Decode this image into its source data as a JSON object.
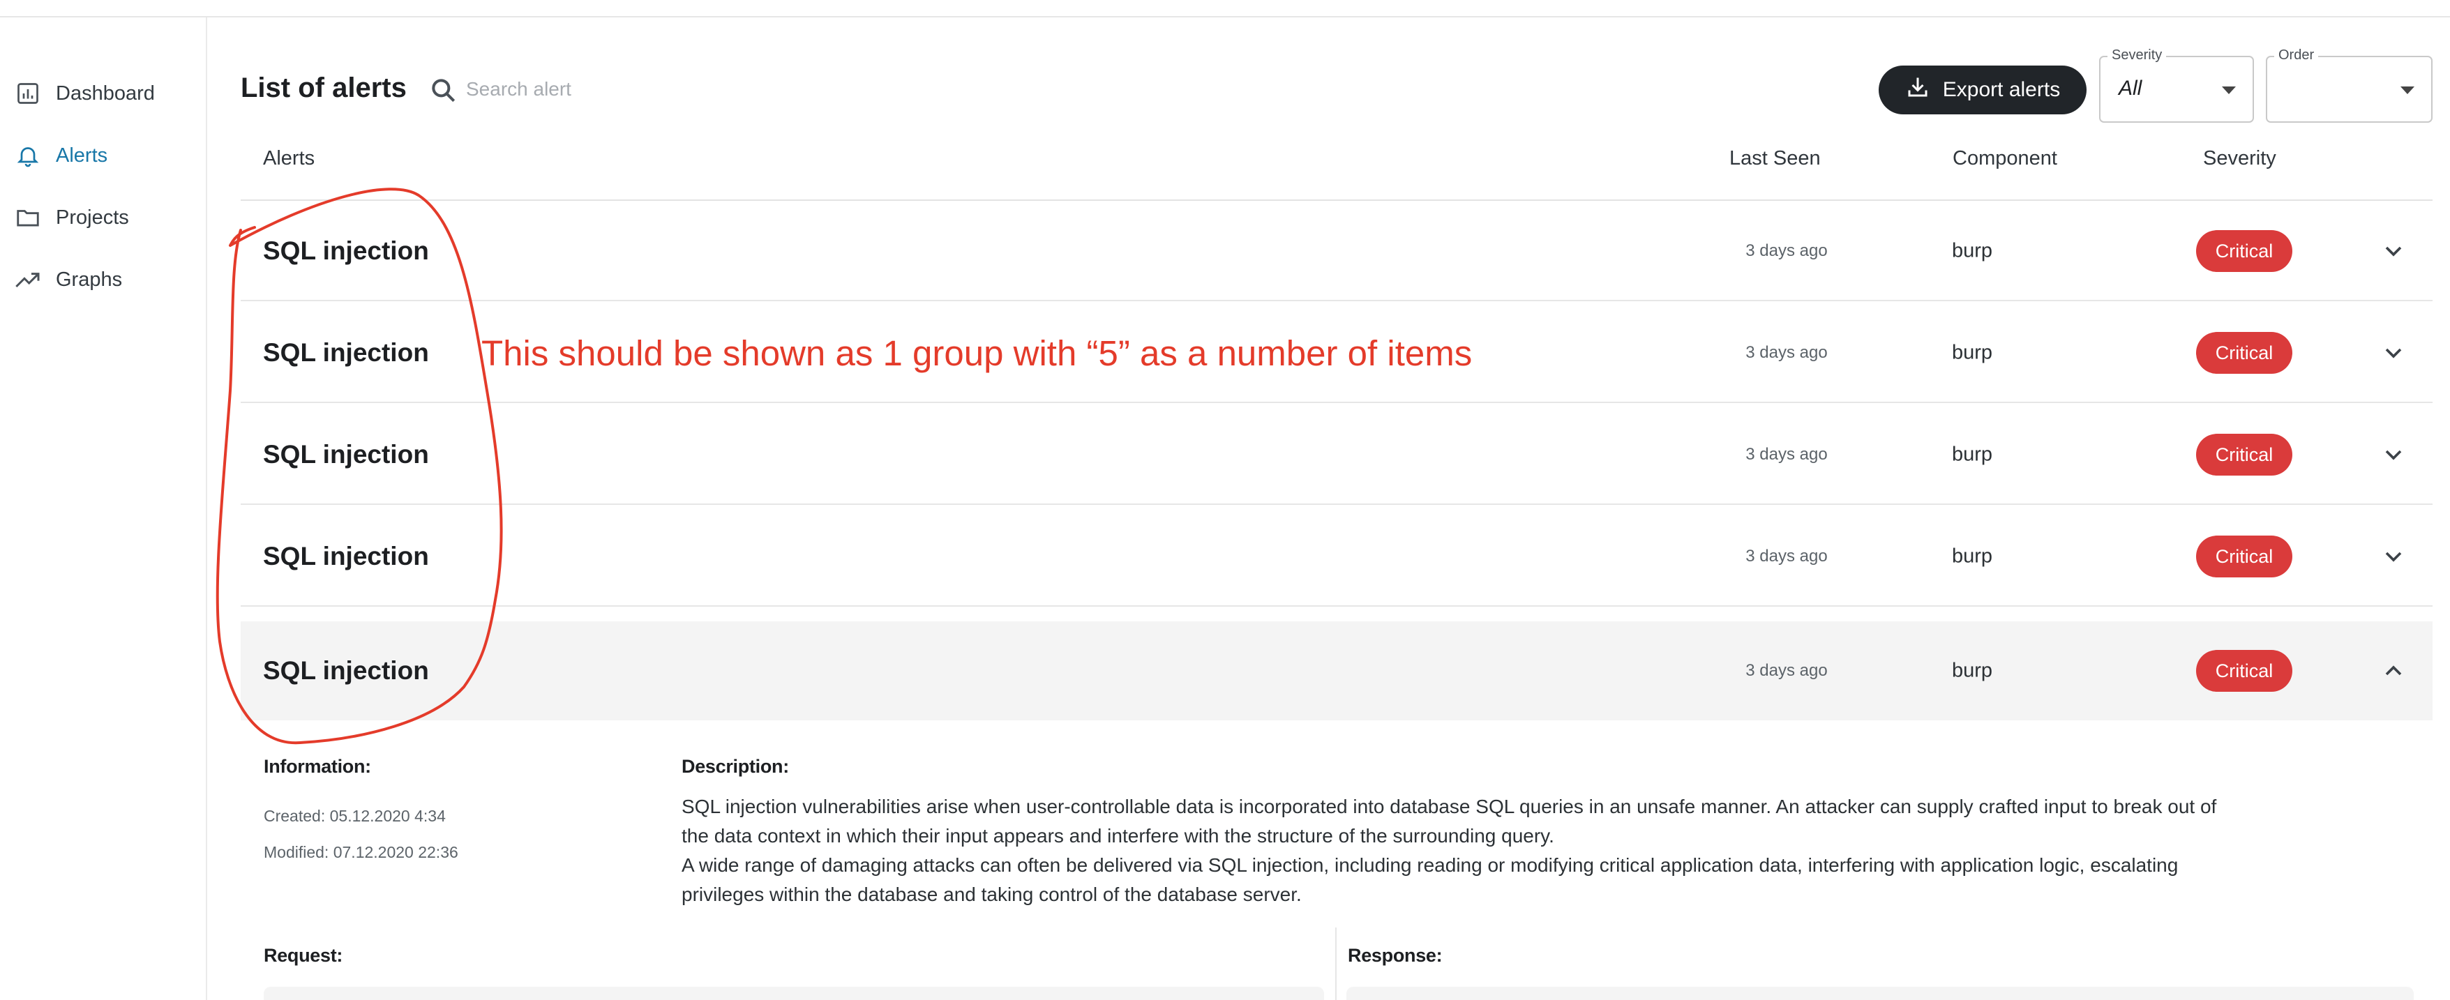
{
  "sidebar": {
    "items": [
      {
        "label": "Dashboard",
        "icon": "chart-box-icon"
      },
      {
        "label": "Alerts",
        "icon": "bell-icon",
        "active": true
      },
      {
        "label": "Projects",
        "icon": "folder-icon"
      },
      {
        "label": "Graphs",
        "icon": "trending-up-icon"
      }
    ]
  },
  "header": {
    "title": "List of alerts",
    "search_placeholder": "Search alert",
    "export_label": "Export alerts",
    "severity_filter": {
      "legend": "Severity",
      "value": "All"
    },
    "order_filter": {
      "legend": "Order",
      "value": ""
    }
  },
  "table": {
    "columns": [
      "Alerts",
      "Last Seen",
      "Component",
      "Severity"
    ],
    "rows": [
      {
        "name": "SQL injection",
        "last_seen": "3 days ago",
        "component": "burp",
        "severity": "Critical",
        "expanded": false
      },
      {
        "name": "SQL injection",
        "last_seen": "3 days ago",
        "component": "burp",
        "severity": "Critical",
        "expanded": false
      },
      {
        "name": "SQL injection",
        "last_seen": "3 days ago",
        "component": "burp",
        "severity": "Critical",
        "expanded": false
      },
      {
        "name": "SQL injection",
        "last_seen": "3 days ago",
        "component": "burp",
        "severity": "Critical",
        "expanded": false
      },
      {
        "name": "SQL injection",
        "last_seen": "3 days ago",
        "component": "burp",
        "severity": "Critical",
        "expanded": true
      }
    ]
  },
  "details": {
    "information_label": "Information:",
    "created": "Created: 05.12.2020 4:34",
    "modified": "Modified: 07.12.2020 22:36",
    "description_label": "Description:",
    "description_lines": [
      "SQL injection vulnerabilities arise when user-controllable data is incorporated into database SQL queries in an unsafe manner. An attacker can supply crafted input to break out of",
      "the data context in which their input appears and interfere with the structure of the surrounding query.",
      "A wide range of damaging attacks can often be delivered via SQL injection, including reading or modifying critical application data, interfering with application logic, escalating",
      "privileges within the database and taking control of the database server."
    ],
    "request_label": "Request:",
    "response_label": "Response:"
  },
  "annotation": {
    "text": "This should be shown as 1 group with “5” as a number of items",
    "color": "#e43b2a"
  },
  "colors": {
    "accent": "#1877a8",
    "critical": "#da3b3b",
    "button_dark": "#212529"
  }
}
